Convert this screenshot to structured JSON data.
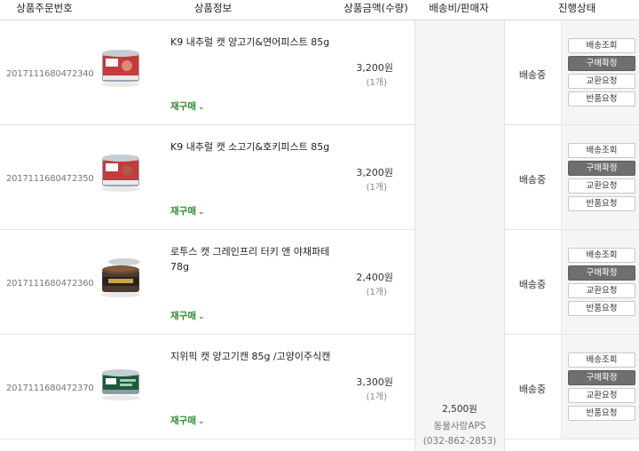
{
  "header": {
    "order_no": "상품주문번호",
    "product_info": "상품정보",
    "price_qty": "상품금액(수량)",
    "shipping_seller": "배송비/판매자",
    "status": "진행상태"
  },
  "rows": [
    {
      "order_no": "2017111680472340",
      "name": "K9 내추럴 캣 양고기&연어피스트 85g",
      "price": "3,200원",
      "qty": "(1개)",
      "rebuy": "재구매",
      "status": "배송중",
      "image": "cat-food-can-red-label",
      "buttons": [
        "배송조회",
        "구매확정",
        "교환요청",
        "반품요청"
      ]
    },
    {
      "order_no": "2017111680472350",
      "name": "K9 내추럴 캣 소고기&호키피스트 85g",
      "price": "3,200원",
      "qty": "(1개)",
      "rebuy": "재구매",
      "status": "배송중",
      "image": "cat-food-can-red-label",
      "buttons": [
        "배송조회",
        "구매확정",
        "교환요청",
        "반품요청"
      ]
    },
    {
      "order_no": "2017111680472360",
      "name": "로투스 캣 그레인프리 터키 앤 야채파테 78g",
      "price": "2,400원",
      "qty": "(1개)",
      "rebuy": "재구매",
      "status": "배송중",
      "image": "cat-food-can-open-pate",
      "buttons": [
        "배송조회",
        "구매확정",
        "교환요청",
        "반품요청"
      ]
    },
    {
      "order_no": "2017111680472370",
      "name": "지위픽 캣 양고기캔 85g /고양이주식캔",
      "price": "3,300원",
      "qty": "(1개)",
      "rebuy": "재구매",
      "status": "배송중",
      "image": "cat-food-can-green-label",
      "buttons": [
        "배송조회",
        "구매확정",
        "교환요청",
        "반품요청"
      ]
    }
  ],
  "shipping": {
    "fee": "2,500원",
    "seller": "동물사랑APS",
    "phone": "(032-862-2853)"
  },
  "colors": {
    "rebuy": "#2e8b2e",
    "confirm_button": "#6f6f6f",
    "panel_bg": "#f5f5f5",
    "border": "#e4e4e4"
  }
}
